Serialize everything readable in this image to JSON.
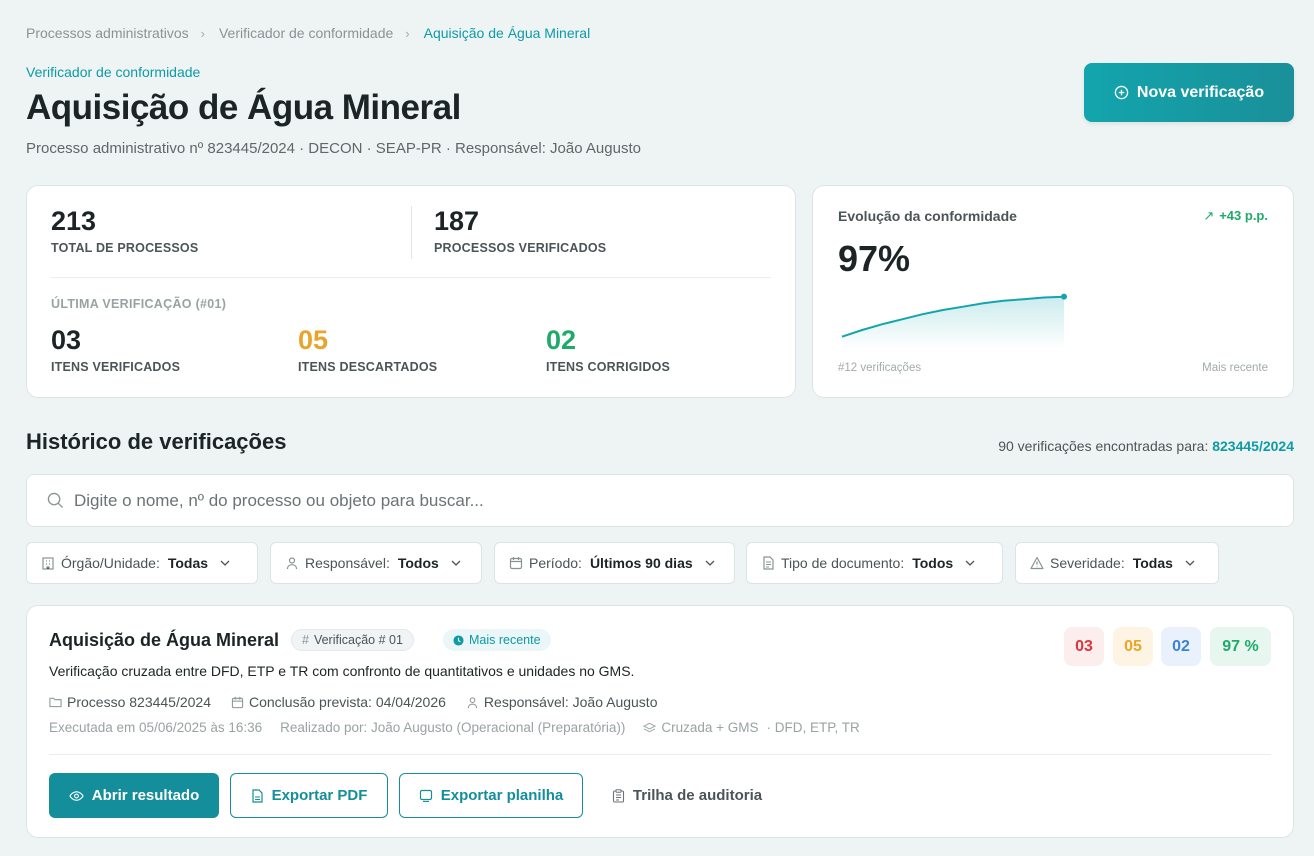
{
  "breadcrumb": {
    "items": [
      "Processos administrativos",
      "Verificador de conformidade",
      "Aquisição de Água Mineral"
    ]
  },
  "header": {
    "eyebrow": "Verificador de conformidade",
    "title": "Aquisição de Água Mineral",
    "subtitle": "Processo administrativo nº 823445/2024 · DECON · SEAP-PR · Responsável: João Augusto",
    "new_button": "Nova verificação"
  },
  "stats": {
    "total": "213",
    "total_label": "TOTAL DE PROCESSOS",
    "verified": "187",
    "verified_label": "PROCESSOS VERIFICADOS",
    "last_label": "ÚLTIMA VERIFICAÇÃO (#01)",
    "items_checked": "03",
    "items_checked_label": "ITENS VERIFICADOS",
    "items_discarded": "05",
    "items_discarded_label": "ITENS DESCARTADOS",
    "items_fixed": "02",
    "items_fixed_label": "ITENS CORRIGIDOS"
  },
  "evolution": {
    "title": "Evolução da conformidade",
    "delta": "+43 p.p.",
    "value": "97%",
    "foot_left": "#12 verificações",
    "foot_right": "Mais recente",
    "trend": [
      10,
      18,
      25,
      31,
      37,
      42,
      46,
      50,
      53,
      55,
      57,
      58
    ]
  },
  "history": {
    "title": "Histórico de verificações",
    "count_text": "90 verificações encontradas para:",
    "count_process": "823445/2024",
    "search_placeholder": "Digite o nome, nº do processo ou objeto para buscar..."
  },
  "filters": [
    {
      "label": "Órgão/Unidade:",
      "value": "Todas"
    },
    {
      "label": "Responsável:",
      "value": "Todos"
    },
    {
      "label": "Período:",
      "value": "Últimos 90 dias"
    },
    {
      "label": "Tipo de documento:",
      "value": "Todos"
    },
    {
      "label": "Severidade:",
      "value": "Todas"
    }
  ],
  "result": {
    "title": "Aquisição de Água Mineral",
    "tag_version": "Verificação # 01",
    "tag_recent": "Mais recente",
    "badges": [
      "03",
      "05",
      "02",
      "97 %"
    ],
    "badge_colors": [
      "#d9363e",
      "#e8a52a",
      "#3b82d6",
      "#1faa6a"
    ],
    "description": "Verificação cruzada entre DFD, ETP e TR com confronto de quantitativos e unidades no GMS.",
    "process": "Processo 823445/2024",
    "due": "Conclusão prevista: 04/04/2026",
    "responsible": "Responsável: João Augusto",
    "executed": "Executada em 05/06/2025 às 16:36",
    "performed_by": "Realizado por: João Augusto (Operacional (Preparatória))",
    "mode": "Cruzada + GMS",
    "docs": "· DFD, ETP, TR",
    "btn_open": "Abrir resultado",
    "btn_pdf": "Exportar PDF",
    "btn_sheet": "Exportar planilha",
    "btn_audit": "Trilha de auditoria"
  },
  "colors": {
    "accent": "#0e9aa6",
    "orange": "#e8a52a",
    "green": "#1faa6a",
    "red": "#d9363e",
    "blue": "#3b82d6"
  }
}
